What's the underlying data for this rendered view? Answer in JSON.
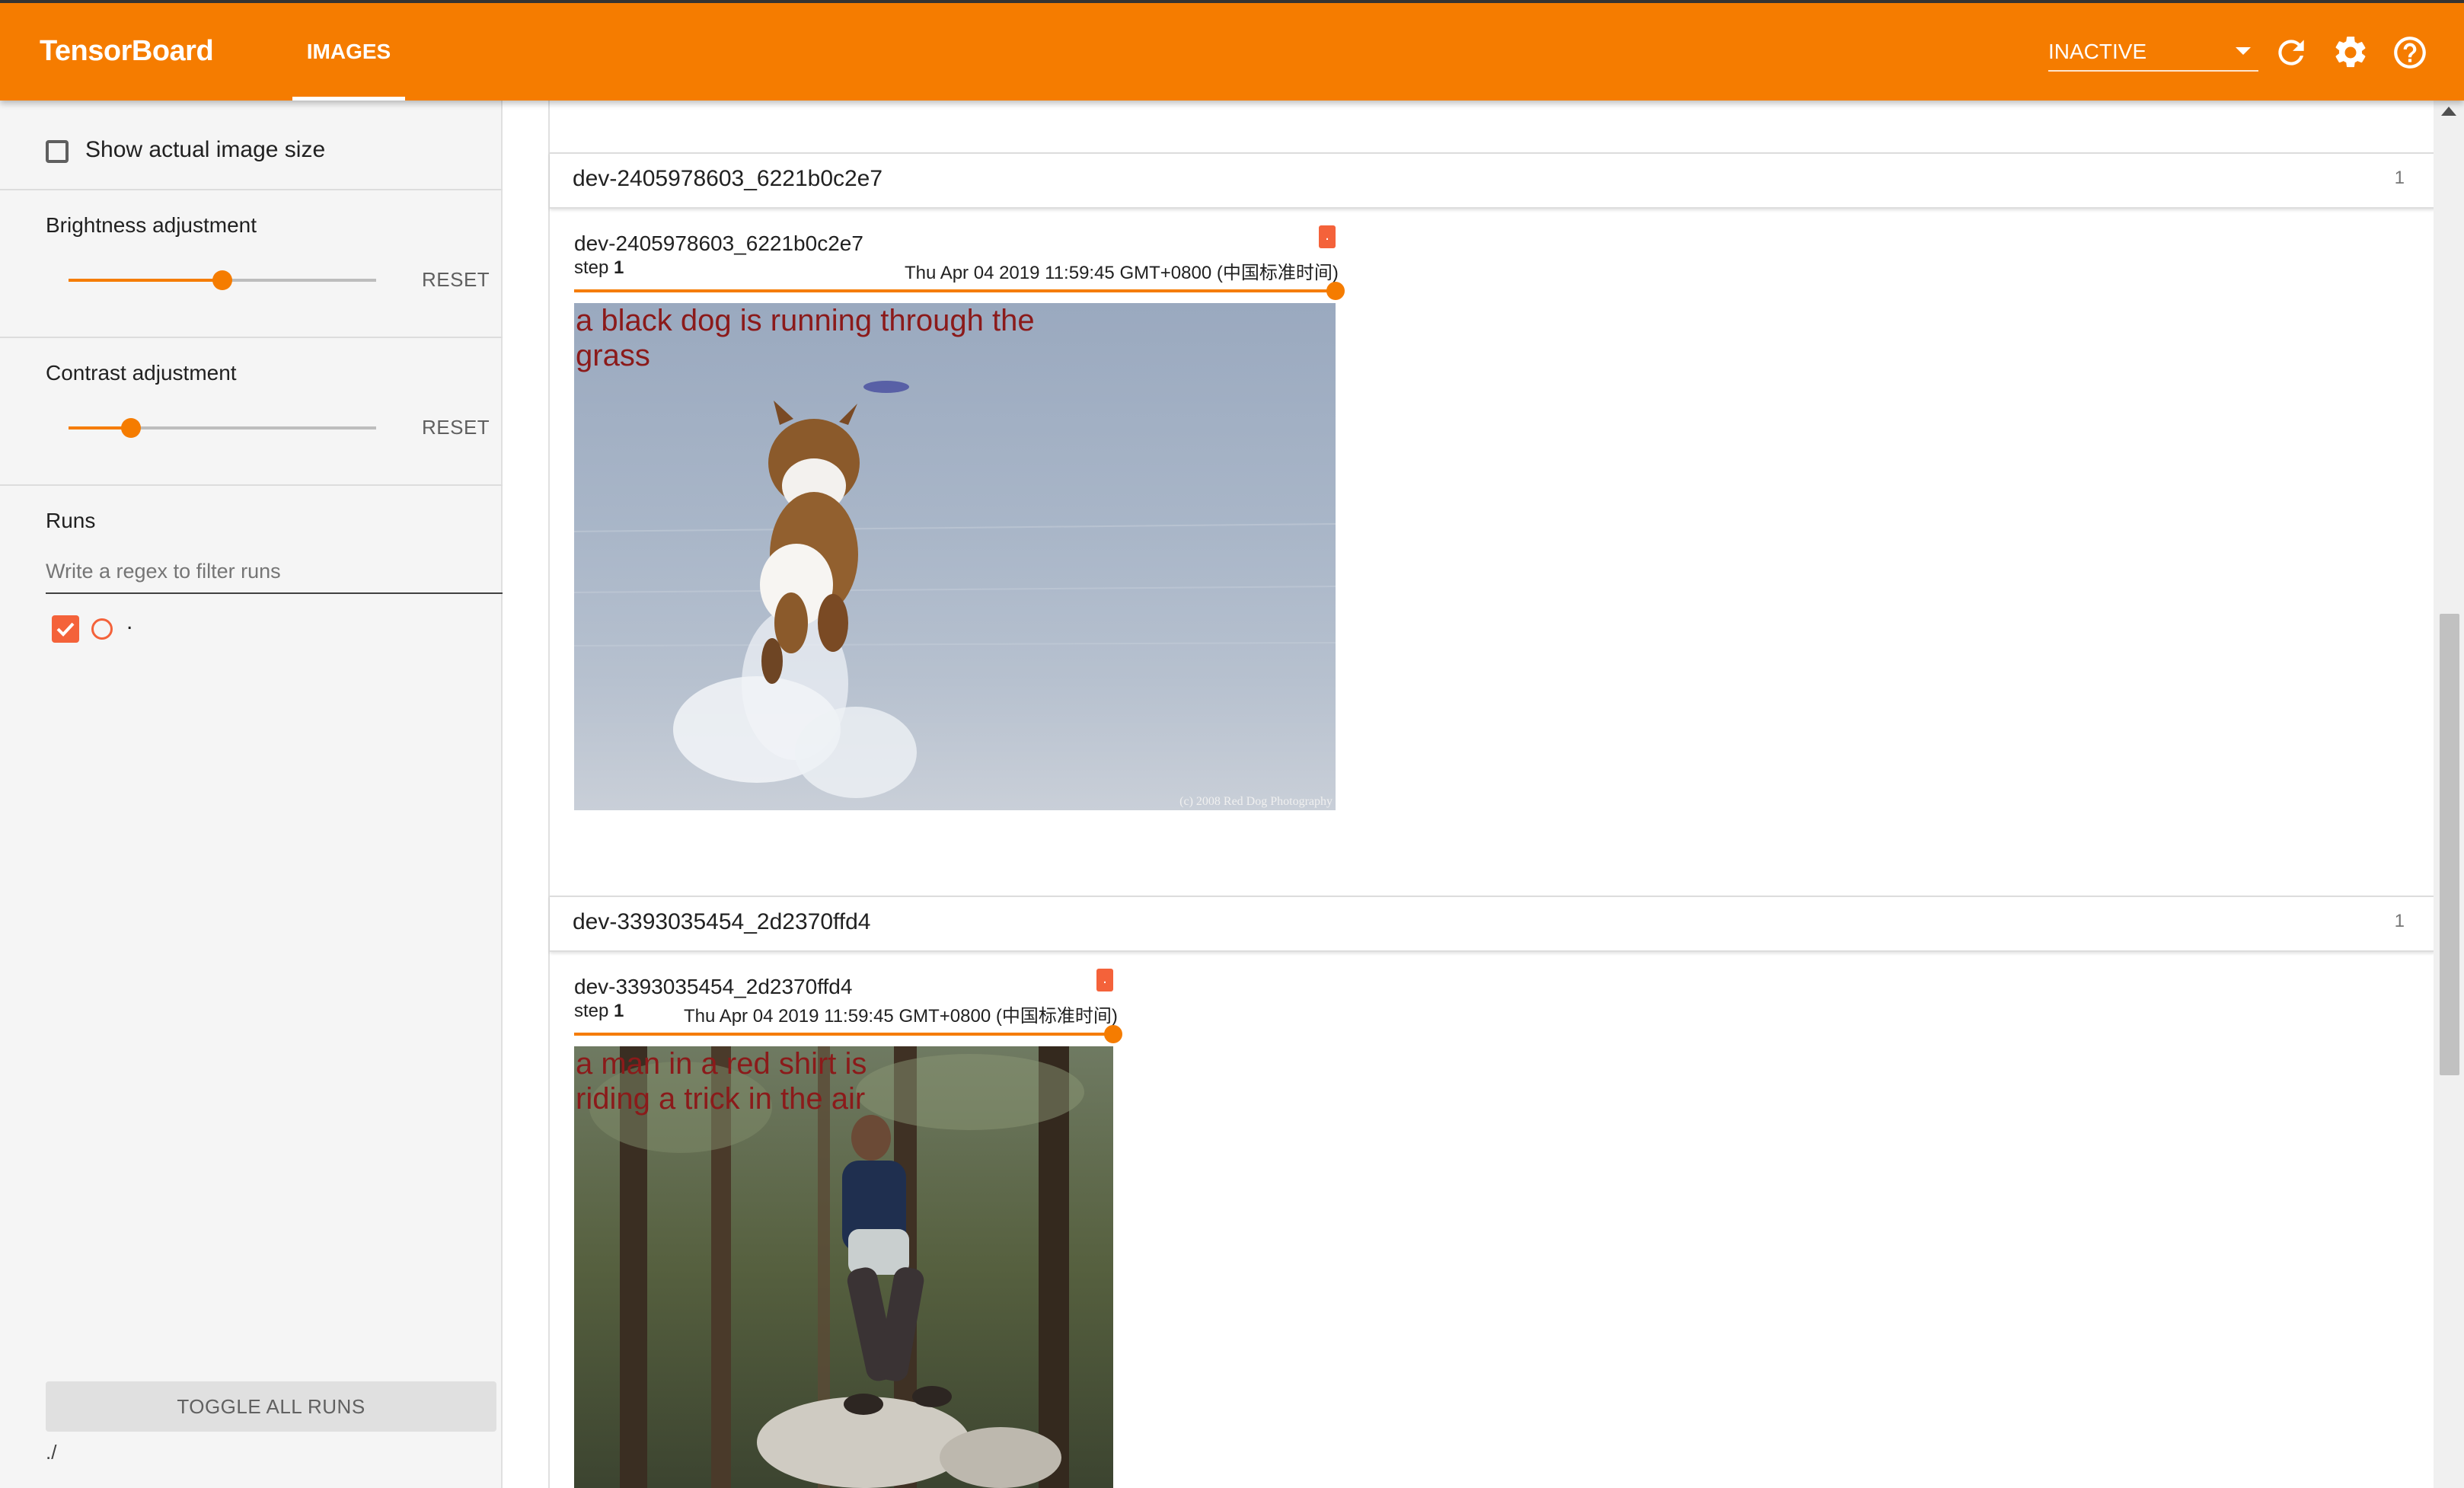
{
  "app": {
    "brand": "TensorBoard",
    "active_tab": "IMAGES",
    "status_select": "INACTIVE",
    "icons": [
      "refresh-icon",
      "settings-icon",
      "help-icon"
    ],
    "accent_color": "#f57c00"
  },
  "sidebar": {
    "show_actual_size_label": "Show actual image size",
    "brightness": {
      "label": "Brightness adjustment",
      "reset_label": "RESET",
      "value": 0.5
    },
    "contrast": {
      "label": "Contrast adjustment",
      "reset_label": "RESET",
      "value": 0.2
    },
    "runs": {
      "label": "Runs",
      "filter_placeholder": "Write a regex to filter runs",
      "items": [
        {
          "name": ".",
          "checked": true,
          "color": "#f4623a"
        }
      ]
    },
    "toggle_all_label": "TOGGLE ALL RUNS",
    "logdir": "./"
  },
  "cards": [
    {
      "tag": "dev-2405978603_6221b0c2e7",
      "count": "1",
      "image": {
        "title": "dev-2405978603_6221b0c2e7",
        "step_label": "step",
        "step": "1",
        "timestamp": "Thu Apr 04 2019 11:59:45 GMT+0800 (中国标准时间)",
        "caption": "a black dog is running through the grass",
        "run_tag": ".",
        "watermark": "(c) 2008 Red Dog Photography"
      }
    },
    {
      "tag": "dev-3393035454_2d2370ffd4",
      "count": "1",
      "image": {
        "title": "dev-3393035454_2d2370ffd4",
        "step_label": "step",
        "step": "1",
        "timestamp": "Thu Apr 04 2019 11:59:45 GMT+0800 (中国标准时间)",
        "caption": "a man in a red shirt is riding a trick in the air",
        "run_tag": "."
      }
    }
  ]
}
